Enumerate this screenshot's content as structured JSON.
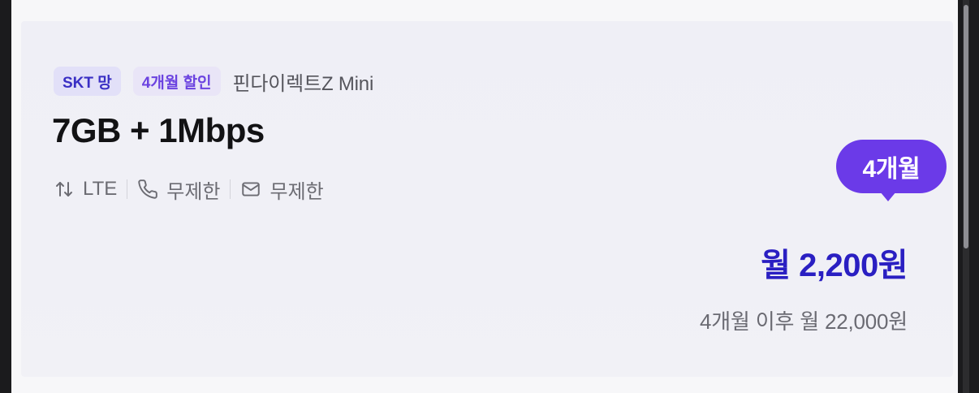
{
  "plan": {
    "badges": {
      "network": "SKT 망",
      "discount": "4개월 할인"
    },
    "carrier": "핀다이렉트Z Mini",
    "title": "7GB + 1Mbps",
    "features": {
      "data": "LTE",
      "call": "무제한",
      "sms": "무제한"
    },
    "promo_bubble": "4개월",
    "price": "월 2,200원",
    "after_price": "4개월 이후 월 22,000원"
  },
  "icons": {
    "data": "arrows-up-down-icon",
    "call": "phone-icon",
    "sms": "envelope-icon"
  },
  "colors": {
    "accent": "#6b3ae8",
    "price": "#2a1fc2",
    "network_badge_bg": "#e2e0f8",
    "network_badge_text": "#3a2fc4",
    "discount_badge_bg": "#e9e5f7",
    "discount_badge_text": "#6b43e0"
  }
}
